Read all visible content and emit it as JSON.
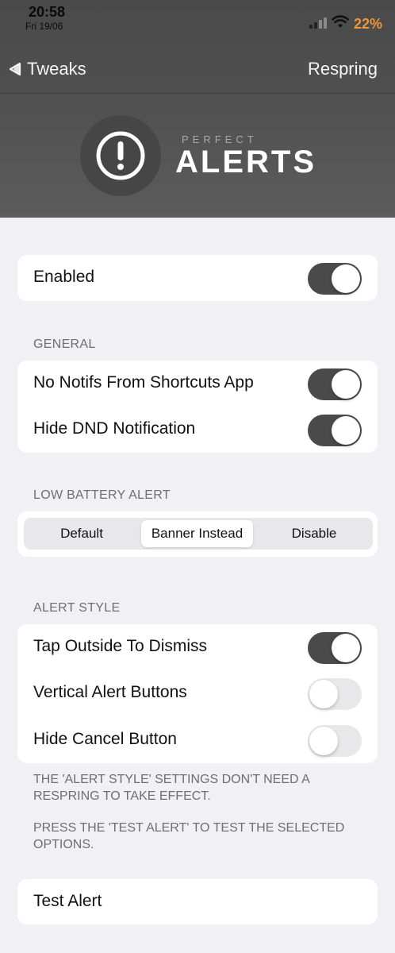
{
  "status_bar": {
    "time": "20:58",
    "date": "Fri 19/06",
    "battery": "22%",
    "icons": [
      "cellular-signal-icon",
      "wifi-icon"
    ]
  },
  "nav": {
    "back_label": "Tweaks",
    "action_label": "Respring"
  },
  "logo": {
    "small_text": "PERFECT",
    "big_text": "ALERTS",
    "icon": "exclamation-circle-icon"
  },
  "enabled": {
    "label": "Enabled",
    "on": true
  },
  "general": {
    "header": "GENERAL",
    "items": [
      {
        "label": "No Notifs From Shortcuts App",
        "on": true
      },
      {
        "label": "Hide DND Notification",
        "on": true
      }
    ]
  },
  "low_battery": {
    "header": "LOW BATTERY ALERT",
    "options": [
      "Default",
      "Banner Instead",
      "Disable"
    ],
    "selected": "Banner Instead"
  },
  "alert_style": {
    "header": "ALERT STYLE",
    "items": [
      {
        "label": "Tap Outside To Dismiss",
        "on": true
      },
      {
        "label": "Vertical Alert Buttons",
        "on": false
      },
      {
        "label": "Hide Cancel Button",
        "on": false
      }
    ],
    "note1": "THE 'ALERT STYLE' SETTINGS DON'T NEED A RESPRING TO TAKE EFFECT.",
    "note2": "PRESS THE 'TEST ALERT' TO TEST THE SELECTED OPTIONS."
  },
  "test_alert": {
    "label": "Test Alert"
  },
  "colors": {
    "header_bg": "#4f4f4f",
    "toggle_on": "#4a4a4a",
    "toggle_off": "#e8e8ea",
    "battery": "#f0943a",
    "page_bg": "#f1f0f5"
  }
}
